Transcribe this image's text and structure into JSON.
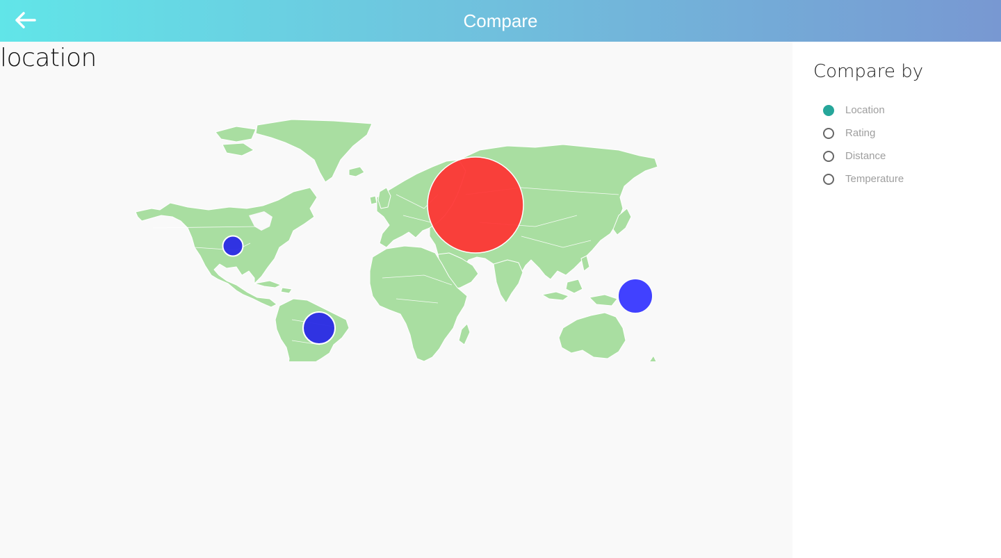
{
  "header": {
    "title": "Compare",
    "back_icon": "arrow-left-icon",
    "background_gradient": [
      "#61e5e8",
      "#7898d2"
    ]
  },
  "main": {
    "heading": "location",
    "map": {
      "land_color": "#a9dea1",
      "border_color": "#ffffff",
      "markers": [
        {
          "name": "russia",
          "color": "#ff3333",
          "relative_size": 1.0
        },
        {
          "name": "usa",
          "color": "#2929e6",
          "relative_size": 0.2
        },
        {
          "name": "brazil",
          "color": "#2929e6",
          "relative_size": 0.33
        },
        {
          "name": "japan",
          "color": "#3333ff",
          "relative_size": 0.36
        }
      ]
    }
  },
  "sidebar": {
    "title": "Compare by",
    "selected": "Location",
    "accent_color": "#26a69a",
    "options": [
      {
        "label": "Location",
        "checked": true
      },
      {
        "label": "Rating",
        "checked": false
      },
      {
        "label": "Distance",
        "checked": false
      },
      {
        "label": "Temperature",
        "checked": false
      }
    ]
  }
}
